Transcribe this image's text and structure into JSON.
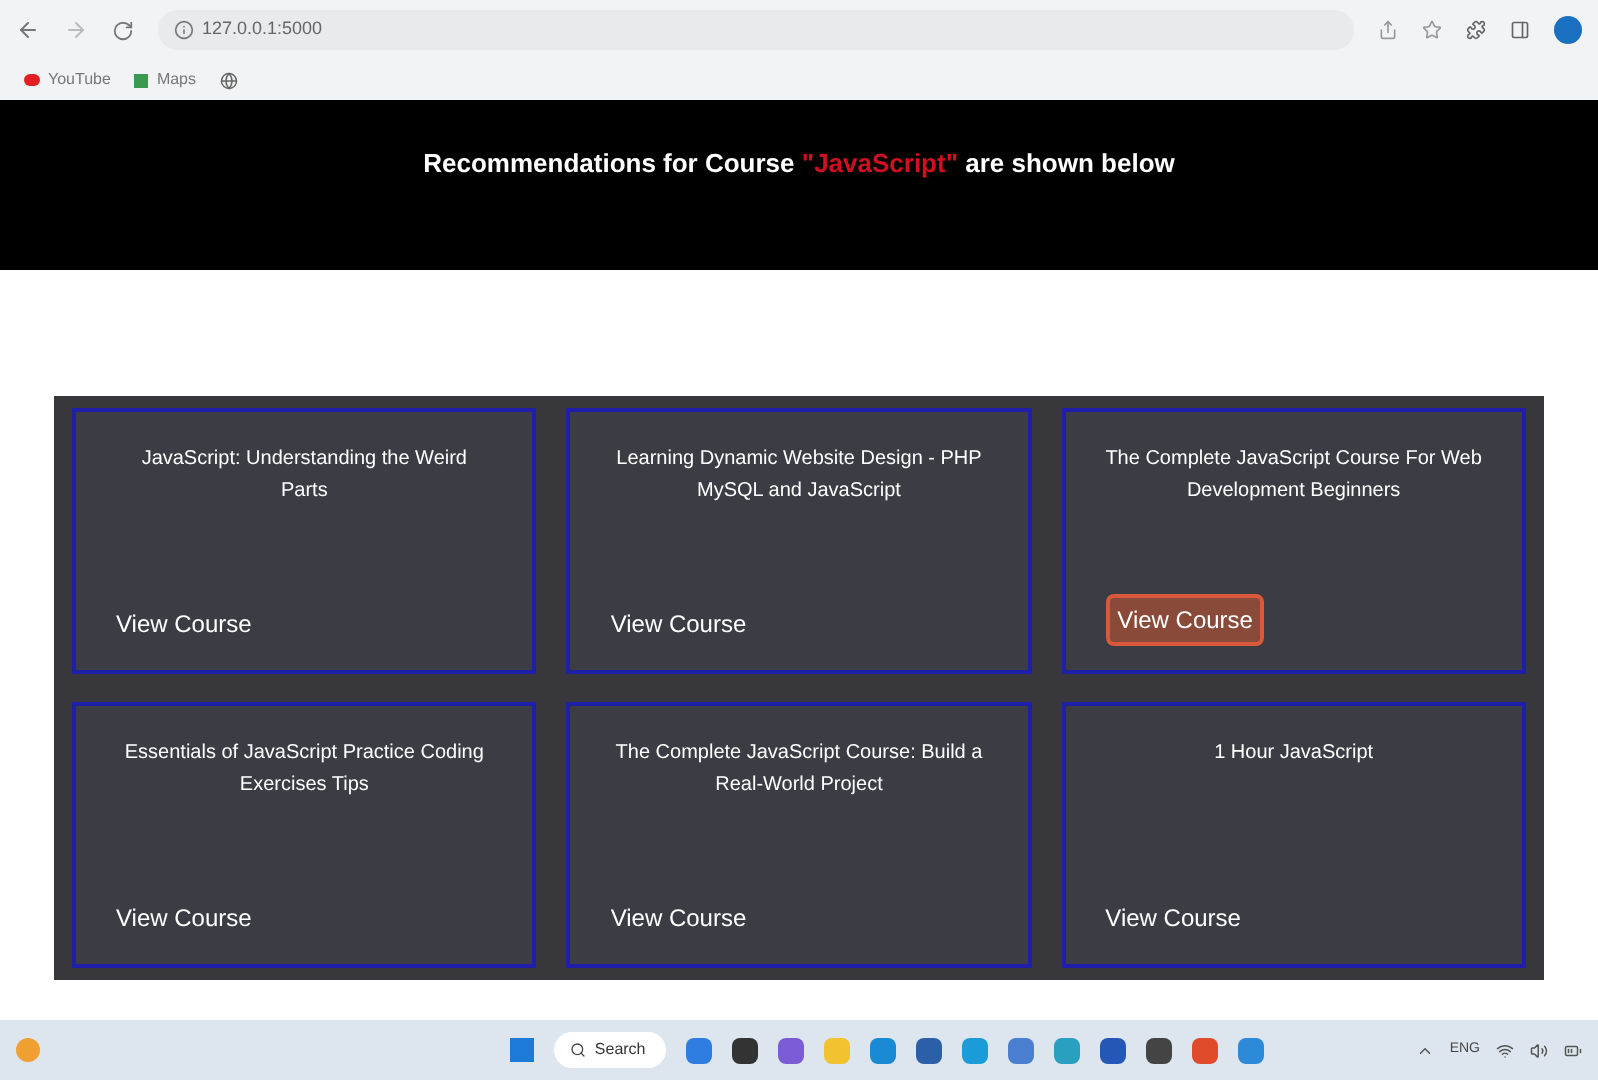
{
  "browser": {
    "url": "127.0.0.1:5000",
    "bookmarks": [
      "YouTube",
      "Maps"
    ]
  },
  "header": {
    "prefix": "Recommendations for Course",
    "course": "\"JavaScript\"",
    "suffix": "are shown below"
  },
  "courses": [
    {
      "title": "JavaScript: Understanding the Weird Parts",
      "button_label": "View Course",
      "highlighted": false
    },
    {
      "title": "Learning Dynamic Website Design - PHP MySQL and JavaScript",
      "button_label": "View Course",
      "highlighted": false
    },
    {
      "title": "The Complete JavaScript Course For Web Development Beginners",
      "button_label": "View Course",
      "highlighted": true
    },
    {
      "title": "Essentials of JavaScript Practice Coding Exercises Tips",
      "button_label": "View Course",
      "highlighted": false
    },
    {
      "title": "The Complete JavaScript Course: Build a Real-World Project",
      "button_label": "View Course",
      "highlighted": false
    },
    {
      "title": "1 Hour JavaScript",
      "button_label": "View Course",
      "highlighted": false
    }
  ],
  "taskbar": {
    "search_label": "Search",
    "language": "ENG"
  }
}
